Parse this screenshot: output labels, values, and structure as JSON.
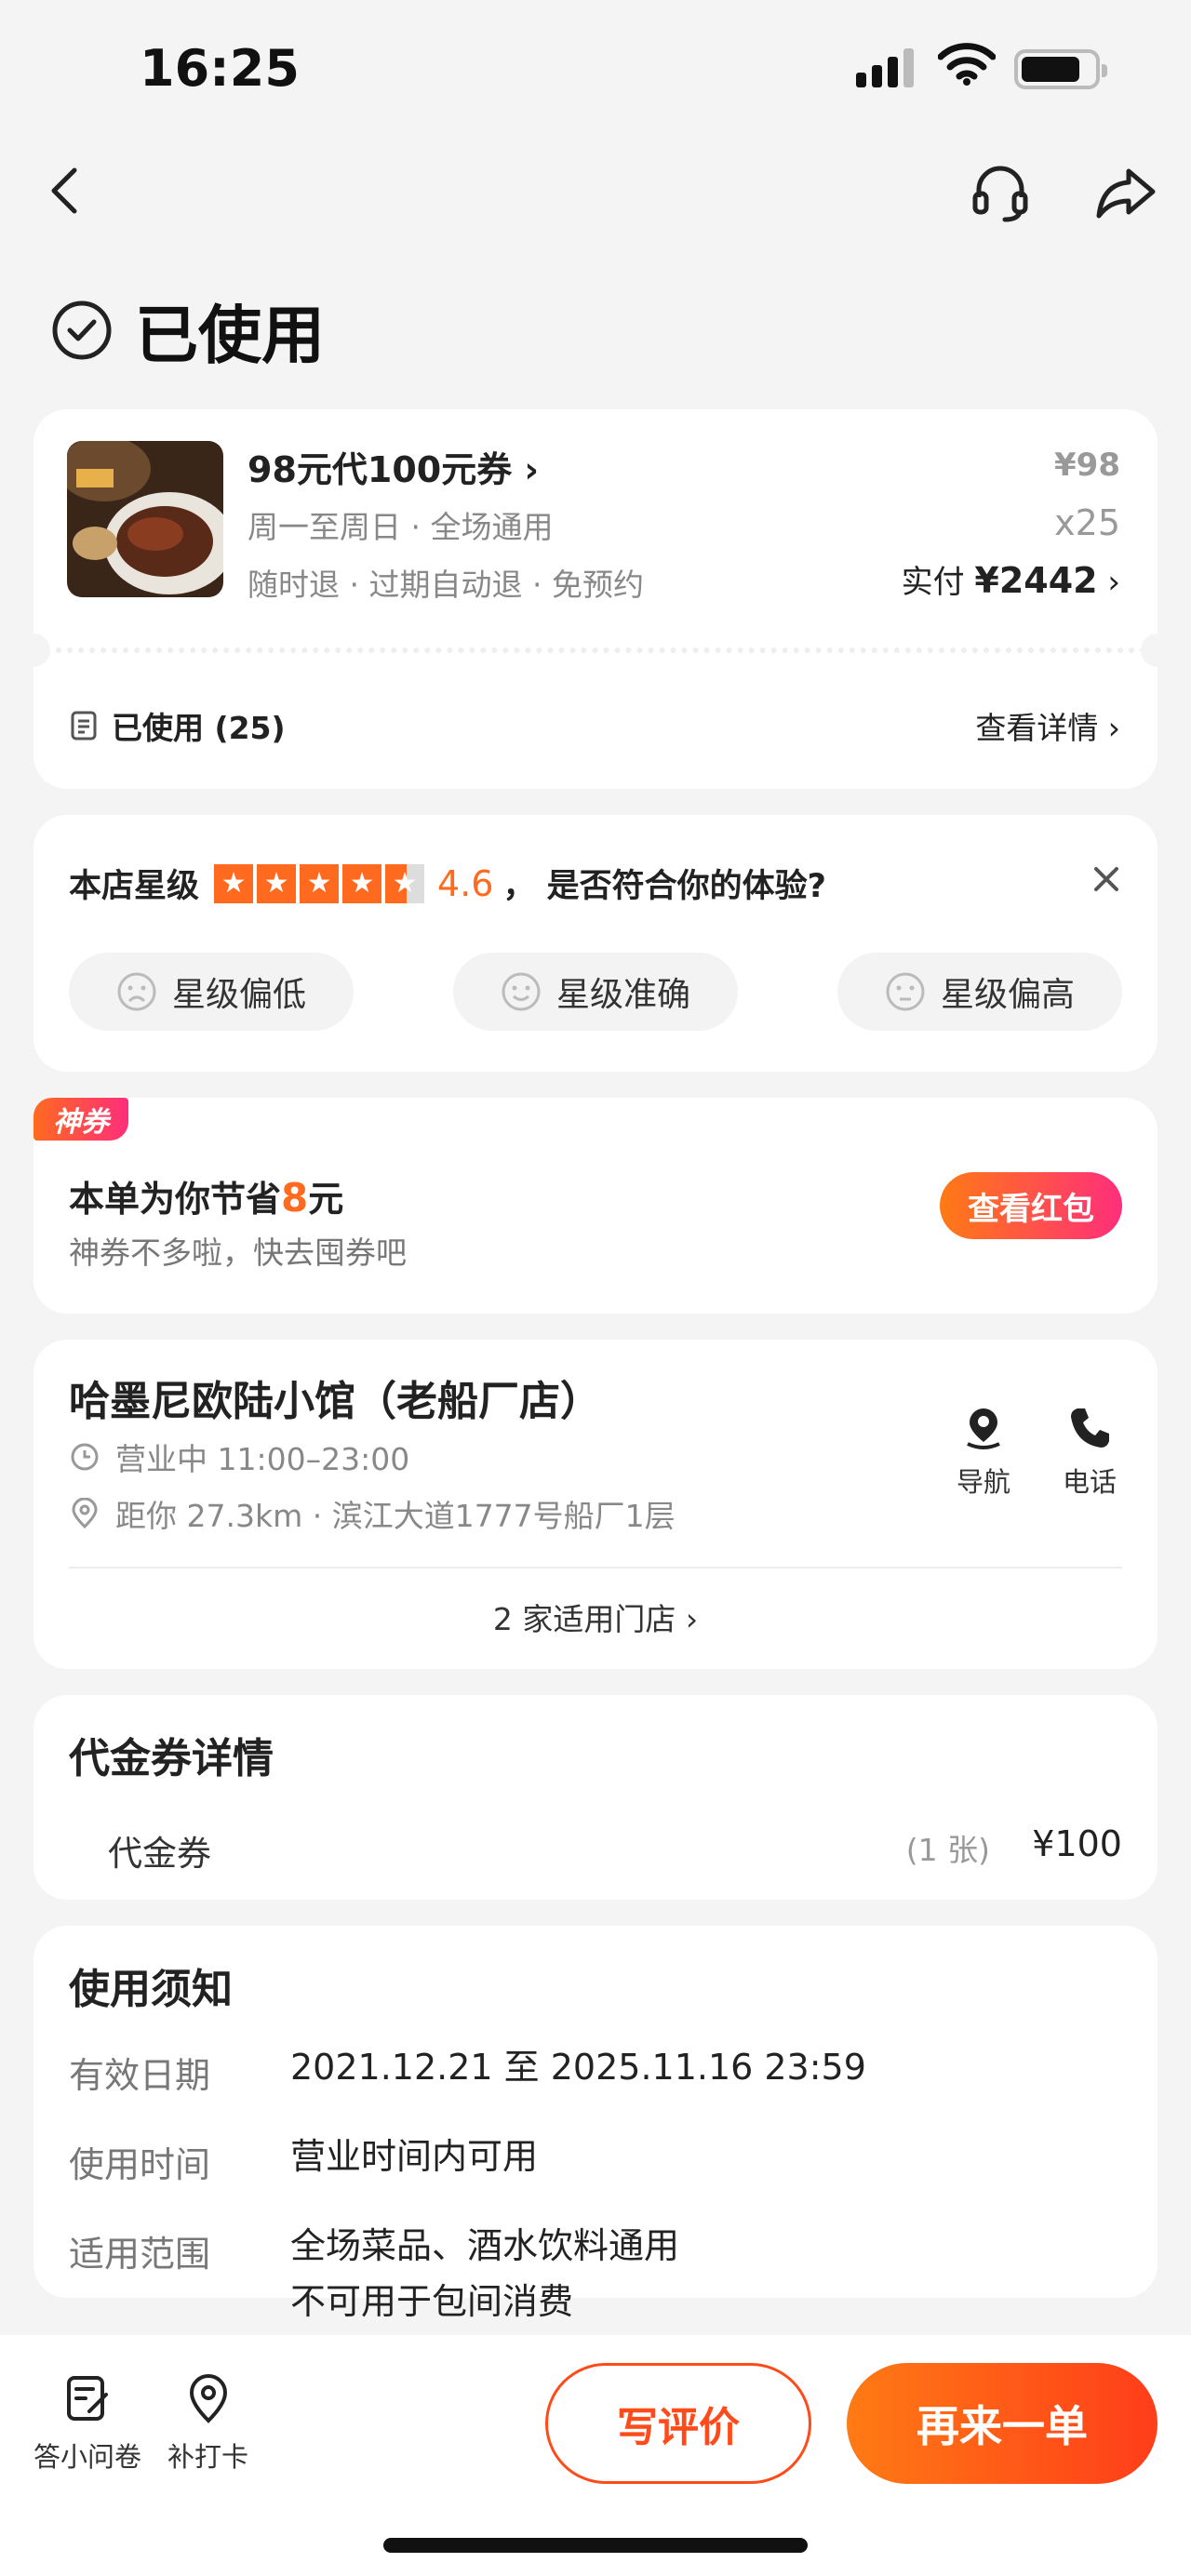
{
  "status_bar": {
    "time": "16:25"
  },
  "header": {
    "status_title": "已使用"
  },
  "deal": {
    "title": "98元代100元券",
    "subtitle1": "周一至周日 · 全场通用",
    "subtitle2": "随时退 · 过期自动退 · 免预约",
    "unit_price": "¥98",
    "quantity": "x25",
    "paid_label": "实付 ",
    "paid_amount": "¥2442",
    "used_label": "已使用 (25)",
    "view_detail": "查看详情"
  },
  "rating": {
    "prefix": "本店星级",
    "stars": 4.6,
    "score": "4.6",
    "question": "，  是否符合你的体验?",
    "options": [
      "星级偏低",
      "星级准确",
      "星级偏高"
    ]
  },
  "coupon": {
    "tag": "神券",
    "title_prefix": "本单为你节省",
    "saved": "8",
    "title_suffix": "元",
    "subtitle": "神券不多啦，快去囤券吧",
    "button": "查看红包"
  },
  "store": {
    "name": "哈墨尼欧陆小馆（老船厂店）",
    "hours": "营业中 11:00–23:00",
    "address": "距你 27.3km ·  滨江大道1777号船厂1层",
    "nav_label": "导航",
    "phone_label": "电话",
    "applicable": "2 家适用门店"
  },
  "voucher": {
    "title": "代金券详情",
    "name": "代金券",
    "count": "(1 张)",
    "price": "¥100"
  },
  "notice": {
    "title": "使用须知",
    "rows": [
      {
        "label": "有效日期",
        "value": "2021.12.21 至 2025.11.16 23:59"
      },
      {
        "label": "使用时间",
        "value": "营业时间内可用"
      },
      {
        "label": "适用范围",
        "value": "全场菜品、酒水饮料通用",
        "value2": "不可用于包间消费"
      }
    ]
  },
  "bottom_bar": {
    "survey": "答小问卷",
    "checkin": "补打卡",
    "review": "写评价",
    "reorder": "再来一单"
  },
  "colors": {
    "accent": "#ff6a1f",
    "accent_red": "#ff3d1a",
    "pink": "#ff2e7b"
  }
}
